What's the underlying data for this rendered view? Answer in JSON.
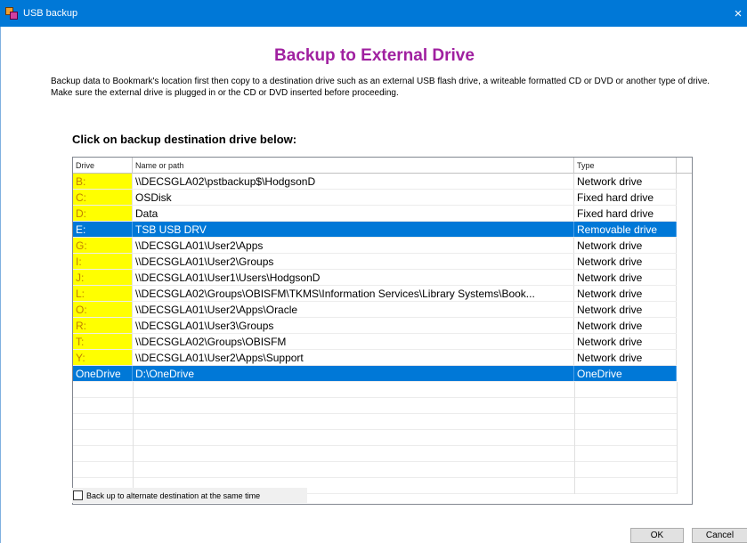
{
  "window": {
    "title": "USB backup",
    "close_glyph": "×"
  },
  "heading": "Backup to External Drive",
  "description": "Backup data to Bookmark's location first then copy to a destination drive such as an external USB flash drive, a writeable formatted CD or DVD or another type of drive.  Make sure the external drive is plugged in or the CD or DVD inserted before proceeding.",
  "subheading": "Click on backup destination drive below:",
  "table": {
    "columns": [
      "Drive",
      "Name or path",
      "Type"
    ],
    "rows": [
      {
        "drive": "B:",
        "path": "\\\\DECSGLA02\\pstbackup$\\HodgsonD",
        "type": "Network drive",
        "highlight": true,
        "selected": false
      },
      {
        "drive": "C:",
        "path": "OSDisk",
        "type": "Fixed hard drive",
        "highlight": true,
        "selected": false
      },
      {
        "drive": "D:",
        "path": "Data",
        "type": "Fixed hard drive",
        "highlight": true,
        "selected": false
      },
      {
        "drive": "E:",
        "path": "TSB USB DRV",
        "type": "Removable drive",
        "highlight": false,
        "selected": true
      },
      {
        "drive": "G:",
        "path": "\\\\DECSGLA01\\User2\\Apps",
        "type": "Network drive",
        "highlight": true,
        "selected": false
      },
      {
        "drive": "I:",
        "path": "\\\\DECSGLA01\\User2\\Groups",
        "type": "Network drive",
        "highlight": true,
        "selected": false
      },
      {
        "drive": "J:",
        "path": "\\\\DECSGLA01\\User1\\Users\\HodgsonD",
        "type": "Network drive",
        "highlight": true,
        "selected": false
      },
      {
        "drive": "L:",
        "path": "\\\\DECSGLA02\\Groups\\OBISFM\\TKMS\\Information Services\\Library Systems\\Book...",
        "type": "Network drive",
        "highlight": true,
        "selected": false
      },
      {
        "drive": "O:",
        "path": "\\\\DECSGLA01\\User2\\Apps\\Oracle",
        "type": "Network drive",
        "highlight": true,
        "selected": false
      },
      {
        "drive": "R:",
        "path": "\\\\DECSGLA01\\User3\\Groups",
        "type": "Network drive",
        "highlight": true,
        "selected": false
      },
      {
        "drive": "T:",
        "path": "\\\\DECSGLA02\\Groups\\OBISFM",
        "type": "Network drive",
        "highlight": true,
        "selected": false
      },
      {
        "drive": "Y:",
        "path": "\\\\DECSGLA01\\User2\\Apps\\Support",
        "type": "Network drive",
        "highlight": true,
        "selected": false
      },
      {
        "drive": "OneDrive",
        "path": "D:\\OneDrive",
        "type": "OneDrive",
        "highlight": false,
        "selected": true
      }
    ]
  },
  "alternate_label": "Back up to alternate destination at the same time",
  "buttons": {
    "ok": "OK",
    "cancel": "Cancel"
  },
  "colors": {
    "titlebar": "#0078d7",
    "heading": "#a020a0",
    "selection": "#0078d7",
    "drive_highlight": "#ffff00"
  }
}
